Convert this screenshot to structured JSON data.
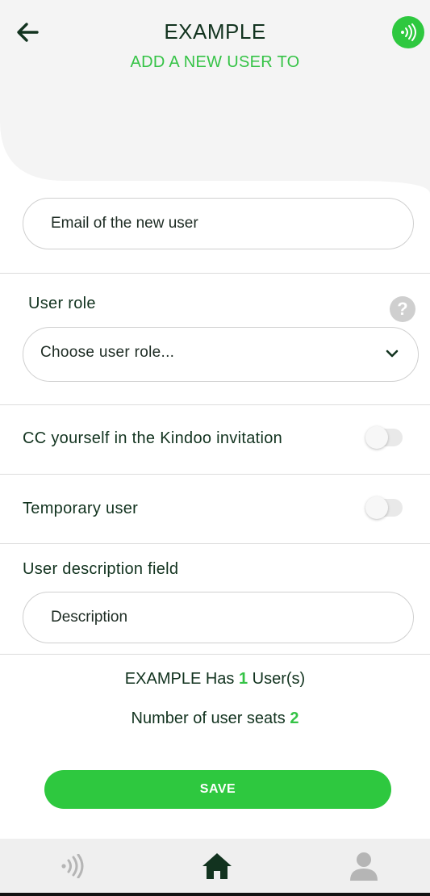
{
  "header": {
    "title": "EXAMPLE",
    "subtitle": "ADD A NEW USER TO"
  },
  "form": {
    "email_placeholder": "Email of the new user",
    "user_role_label": "User role",
    "user_role_help": "?",
    "user_role_select": "Choose user role...",
    "cc_label": "CC yourself in the Kindoo invitation",
    "cc_enabled": false,
    "temporary_label": "Temporary user",
    "temporary_enabled": false,
    "description_label": "User description field",
    "description_placeholder": "Description"
  },
  "info": {
    "users_prefix": "EXAMPLE Has",
    "users_count": "1",
    "users_suffix": "User(s)",
    "seats_prefix": "Number of user seats",
    "seats_count": "2"
  },
  "actions": {
    "save_label": "SAVE"
  },
  "nav": {
    "items": [
      "nfc-icon",
      "home-icon",
      "profile-icon"
    ],
    "active": "home-icon"
  },
  "colors": {
    "accent": "#2ec83f",
    "dark_green": "#12331f",
    "header_bg": "#f4f4f4"
  }
}
